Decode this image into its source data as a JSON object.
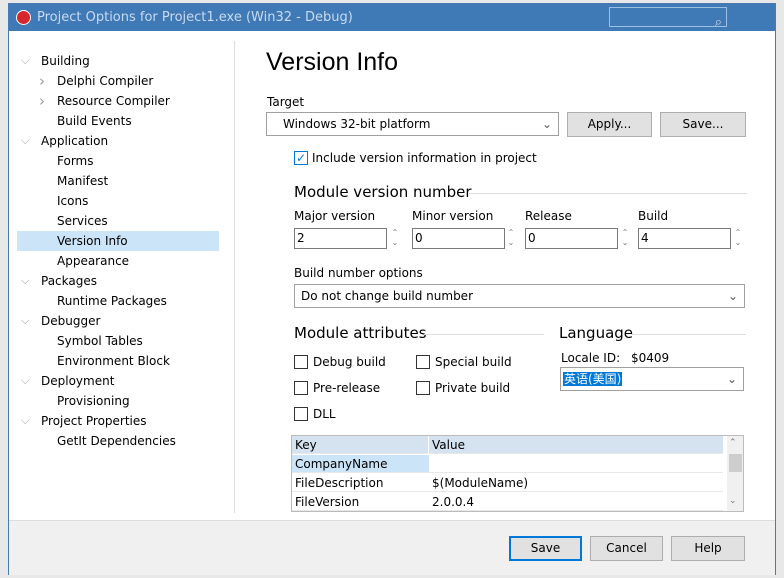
{
  "window": {
    "title": "Project Options for Project1.exe  (Win32 - Debug)",
    "search_icon": "search-icon"
  },
  "tree": [
    {
      "label": "Building",
      "level": 0,
      "toggle": "expanded"
    },
    {
      "label": "Delphi Compiler",
      "level": 1,
      "toggle": "collapsed"
    },
    {
      "label": "Resource Compiler",
      "level": 1,
      "toggle": "collapsed"
    },
    {
      "label": "Build Events",
      "level": 1
    },
    {
      "label": "Application",
      "level": 0,
      "toggle": "expanded"
    },
    {
      "label": "Forms",
      "level": 1
    },
    {
      "label": "Manifest",
      "level": 1
    },
    {
      "label": "Icons",
      "level": 1
    },
    {
      "label": "Services",
      "level": 1
    },
    {
      "label": "Version Info",
      "level": 1,
      "selected": true
    },
    {
      "label": "Appearance",
      "level": 1
    },
    {
      "label": "Packages",
      "level": 0,
      "toggle": "expanded"
    },
    {
      "label": "Runtime Packages",
      "level": 1
    },
    {
      "label": "Debugger",
      "level": 0,
      "toggle": "expanded"
    },
    {
      "label": "Symbol Tables",
      "level": 1
    },
    {
      "label": "Environment Block",
      "level": 1
    },
    {
      "label": "Deployment",
      "level": 0,
      "toggle": "expanded"
    },
    {
      "label": "Provisioning",
      "level": 1
    },
    {
      "label": "Project Properties",
      "level": 0,
      "toggle": "expanded"
    },
    {
      "label": "GetIt Dependencies",
      "level": 1
    }
  ],
  "page": {
    "title": "Version Info",
    "target_label": "Target",
    "target_value": "Windows 32-bit platform",
    "apply": "Apply...",
    "save": "Save...",
    "include_label": "Include version information in project",
    "include_checked": true,
    "module_version_title": "Module version number",
    "major_label": "Major version",
    "major": "2",
    "minor_label": "Minor version",
    "minor": "0",
    "release_label": "Release",
    "release": "0",
    "build_label": "Build",
    "build": "4",
    "build_opts_label": "Build number options",
    "build_opts_value": "Do not change build number",
    "attrs_title": "Module attributes",
    "attrs": {
      "debug": "Debug build",
      "special": "Special build",
      "prerelease": "Pre-release",
      "private": "Private build",
      "dll": "DLL"
    },
    "language_title": "Language",
    "locale_label": "Locale ID:",
    "locale_value": "$0409",
    "language_value": "英语(美国)",
    "grid": {
      "headers": [
        "Key",
        "Value"
      ],
      "rows": [
        [
          "CompanyName",
          ""
        ],
        [
          "FileDescription",
          "$(ModuleName)"
        ],
        [
          "FileVersion",
          "2.0.0.4"
        ]
      ]
    }
  },
  "footer": {
    "save": "Save",
    "cancel": "Cancel",
    "help": "Help"
  },
  "colors": {
    "titlebar": "#3f79b6",
    "selection": "#cce4f7",
    "accent": "#0078d7"
  }
}
